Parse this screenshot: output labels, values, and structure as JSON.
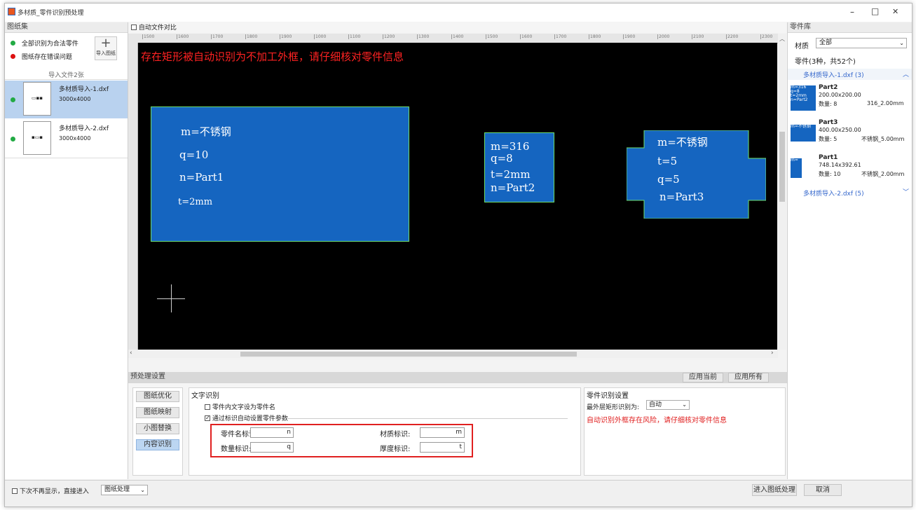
{
  "window": {
    "title": "多材质_零件识别预处理",
    "controls": {
      "minimize": "–",
      "maximize": "□",
      "close": "✕"
    }
  },
  "left_panel": {
    "header": "图纸集",
    "legend": [
      {
        "label": "全部识别为合法零件",
        "color": "#22aa44"
      },
      {
        "label": "图纸存在错误问题",
        "color": "#dd1111"
      }
    ],
    "import_button": "导入图纸",
    "import_count": "导入文件2张",
    "files": [
      {
        "name": "多材质导入-1.dxf",
        "size": "3000x4000",
        "status_color": "#22aa44",
        "selected": true
      },
      {
        "name": "多材质导入-2.dxf",
        "size": "3000x4000",
        "status_color": "#22aa44",
        "selected": false
      }
    ]
  },
  "center": {
    "compare_label": "自动文件对比",
    "ruler_ticks": [
      "1500",
      "1600",
      "1700",
      "1800",
      "1900",
      "1000",
      "1100",
      "1200",
      "1300",
      "1400",
      "1500",
      "1600",
      "1700",
      "1800",
      "1900",
      "2000",
      "2100",
      "2200",
      "2300"
    ],
    "warning_text": "存在矩形被自动识别为不加工外框，请仔细核对零件信息",
    "parts": [
      {
        "lines": [
          "m=不锈钢",
          "q=10",
          "n=Part1",
          "t=2mm"
        ]
      },
      {
        "lines": [
          "m=316",
          "q=8",
          "t=2mm",
          "n=Part2"
        ]
      },
      {
        "lines": [
          "m=不锈钢",
          "t=5",
          "q=5",
          "n=Part3"
        ]
      }
    ]
  },
  "preprocess": {
    "header": "预处理设置",
    "apply_current": "应用当前",
    "apply_all": "应用所有",
    "tabs": [
      "图纸优化",
      "图纸映射",
      "小图替换",
      "内容识别"
    ],
    "active_tab": "内容识别",
    "text_recognition": {
      "title": "文字识别",
      "option1": "零件内文字设为零件名",
      "option1_checked": false,
      "option2": "通过标识自动设置零件参数",
      "option2_checked": true,
      "fields": [
        {
          "label": "零件名标识:",
          "value": "n"
        },
        {
          "label": "材质标识:",
          "value": "m"
        },
        {
          "label": "数量标识:",
          "value": "q"
        },
        {
          "label": "厚度标识:",
          "value": "t"
        }
      ]
    },
    "part_recognition": {
      "title": "零件识别设置",
      "outer_label": "最外层矩形识别为:",
      "outer_value": "自动",
      "warning": "自动识别外框存在风险，请仔细核对零件信息"
    }
  },
  "right_panel": {
    "header": "零件库",
    "material_label": "材质",
    "material_value": "全部",
    "summary": "零件(3种，共52个)",
    "groups": [
      {
        "name": "多材质导入-1.dxf (3)",
        "expanded": true,
        "parts": [
          {
            "name": "Part2",
            "dims": "200.00x200.00",
            "qty_label": "数量: 8",
            "material": "316_2.00mm",
            "thumb_text": "m=316 q=8 t=2mm n=Part2"
          },
          {
            "name": "Part3",
            "dims": "400.00x250.00",
            "qty_label": "数量: 5",
            "material": "不锈钢_5.00mm",
            "thumb_text": "m=不锈钢"
          },
          {
            "name": "Part1",
            "dims": "748.14x392.61",
            "qty_label": "数量: 10",
            "material": "不锈钢_2.00mm",
            "thumb_text": "m="
          }
        ]
      },
      {
        "name": "多材质导入-2.dxf (5)",
        "expanded": false,
        "parts": []
      }
    ]
  },
  "footer": {
    "skip_label": "下次不再显示，直接进入",
    "mode_value": "图纸处理",
    "enter_button": "进入图纸处理",
    "cancel_button": "取消"
  }
}
